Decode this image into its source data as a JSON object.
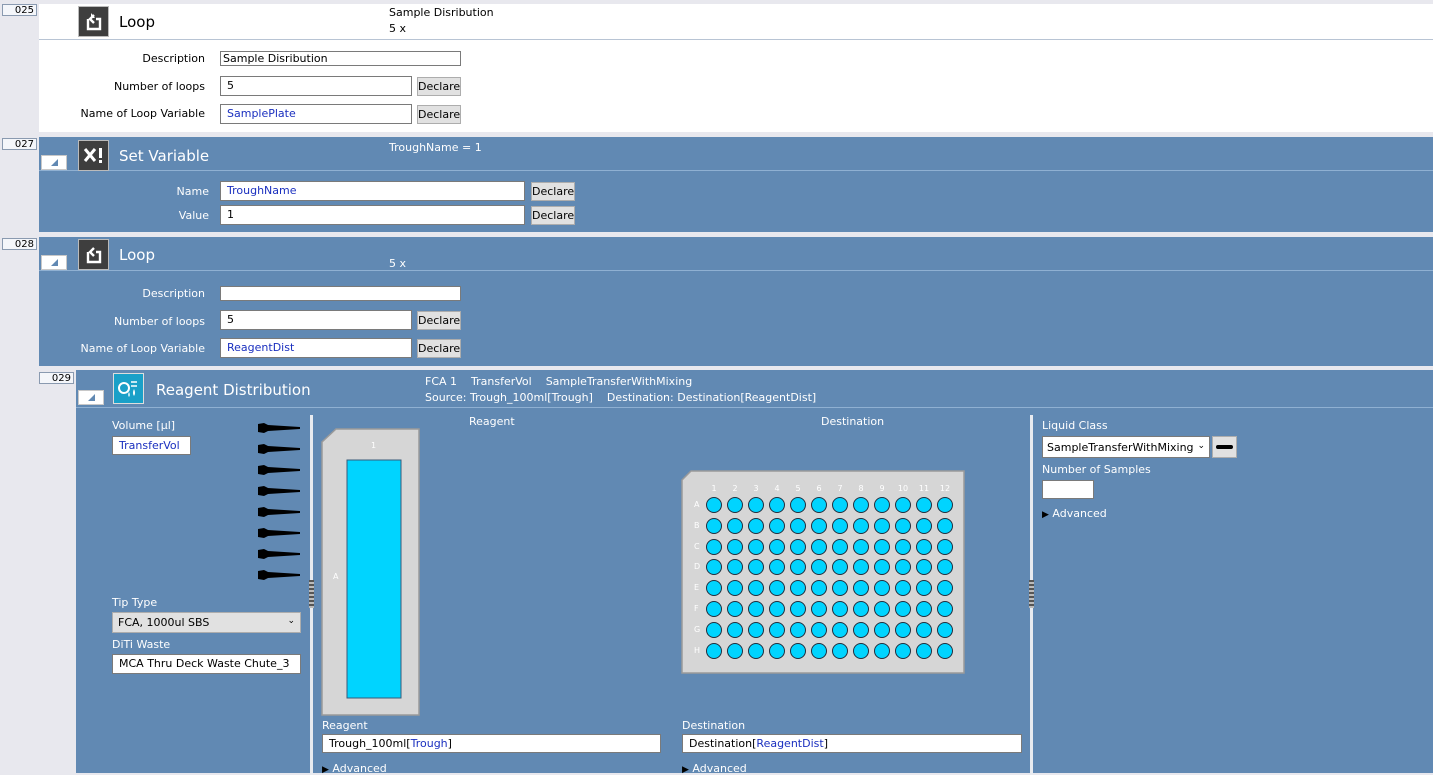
{
  "steps": [
    {
      "number": "025",
      "title": "Loop",
      "summary_line1": "Sample Disribution",
      "summary_line2": "5 x",
      "description_label": "Description",
      "description_value": "Sample Disribution",
      "loops_label": "Number of loops",
      "loops_value": "5",
      "var_label": "Name of Loop Variable",
      "var_value": "SamplePlate",
      "declare_label": "Declare"
    },
    {
      "number": "027",
      "title": "Set Variable",
      "summary_line1": "TroughName = 1",
      "name_label": "Name",
      "name_value": "TroughName",
      "value_label": "Value",
      "value_value": "1",
      "declare_label": "Declare"
    },
    {
      "number": "028",
      "title": "Loop",
      "summary_line2": "5 x",
      "description_label": "Description",
      "description_value": "",
      "loops_label": "Number of loops",
      "loops_value": "5",
      "var_label": "Name of Loop Variable",
      "var_value": "ReagentDist",
      "declare_label": "Declare"
    },
    {
      "number": "029",
      "title": "Reagent Distribution",
      "summary_line1": "FCA 1    TransferVol    SampleTransferWithMixing",
      "summary_line2": "Source: Trough_100ml[Trough]    Destination: Destination[ReagentDist]",
      "volume_label": "Volume [µl]",
      "volume_value": "TransferVol",
      "tip_type_label": "Tip Type",
      "tip_type_value": "FCA, 1000ul SBS",
      "diti_waste_label": "DiTi Waste",
      "diti_waste_value": "MCA Thru Deck Waste Chute_3",
      "reagent_header": "Reagent",
      "destination_header": "Destination",
      "trough_col_label": "1",
      "trough_row_label": "A",
      "reagent_label": "Reagent",
      "reagent_value_prefix": "Trough_100ml[",
      "reagent_value_var": "Trough",
      "reagent_value_suffix": "]",
      "destination_label": "Destination",
      "destination_value_prefix": "Destination[",
      "destination_value_var": "ReagentDist",
      "destination_value_suffix": "]",
      "advanced_label": "Advanced",
      "liquid_class_label": "Liquid Class",
      "liquid_class_value": "SampleTransferWithMixing",
      "num_samples_label": "Number of Samples",
      "num_samples_value": ""
    }
  ],
  "plate": {
    "columns": [
      "1",
      "2",
      "3",
      "4",
      "5",
      "6",
      "7",
      "8",
      "9",
      "10",
      "11",
      "12"
    ],
    "rows": [
      "A",
      "B",
      "C",
      "D",
      "E",
      "F",
      "G",
      "H"
    ]
  },
  "colors": {
    "step_blue": "#6189b3",
    "well_fill": "#00d4ff",
    "trough_fill": "#00d4ff",
    "variable_text": "#1a2fbf"
  },
  "icons": [
    "hamburger-icon",
    "collapse-triangle-icon",
    "loop-icon",
    "set-variable-icon",
    "minus-icon",
    "reagent-distribution-icon",
    "tip-icon",
    "dropdown-arrow-icon",
    "expand-triangle-icon",
    "liquid-class-edit-icon"
  ]
}
